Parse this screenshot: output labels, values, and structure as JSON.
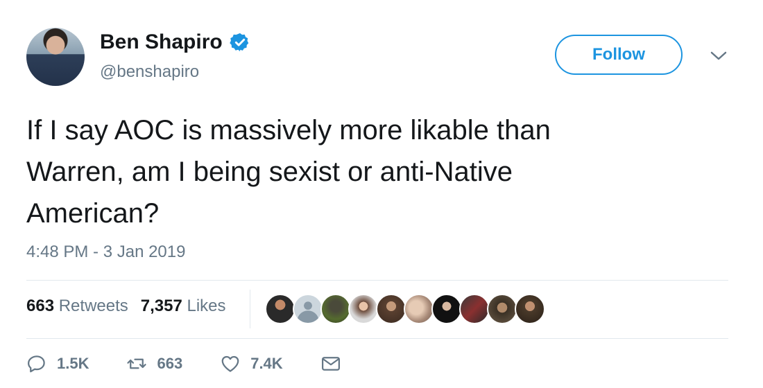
{
  "user": {
    "display_name": "Ben Shapiro",
    "handle": "@benshapiro",
    "verified": true
  },
  "header": {
    "follow_label": "Follow"
  },
  "tweet": {
    "text": "If I say AOC is massively more likable than\nWarren, am I being sexist or anti-Native\nAmerican?",
    "timestamp": "4:48 PM - 3 Jan 2019"
  },
  "stats": {
    "retweets_count": "663",
    "retweets_label": "Retweets",
    "likes_count": "7,357",
    "likes_label": "Likes"
  },
  "actions": {
    "reply_count": "1.5K",
    "retweet_count": "663",
    "like_count": "7.4K"
  },
  "colors": {
    "accent": "#1c94e0",
    "secondary_text": "#657786",
    "divider": "#e1e8ed"
  },
  "icons": [
    "verified-badge-icon",
    "chevron-down-icon",
    "reply-icon",
    "retweet-icon",
    "heart-icon",
    "envelope-icon"
  ]
}
